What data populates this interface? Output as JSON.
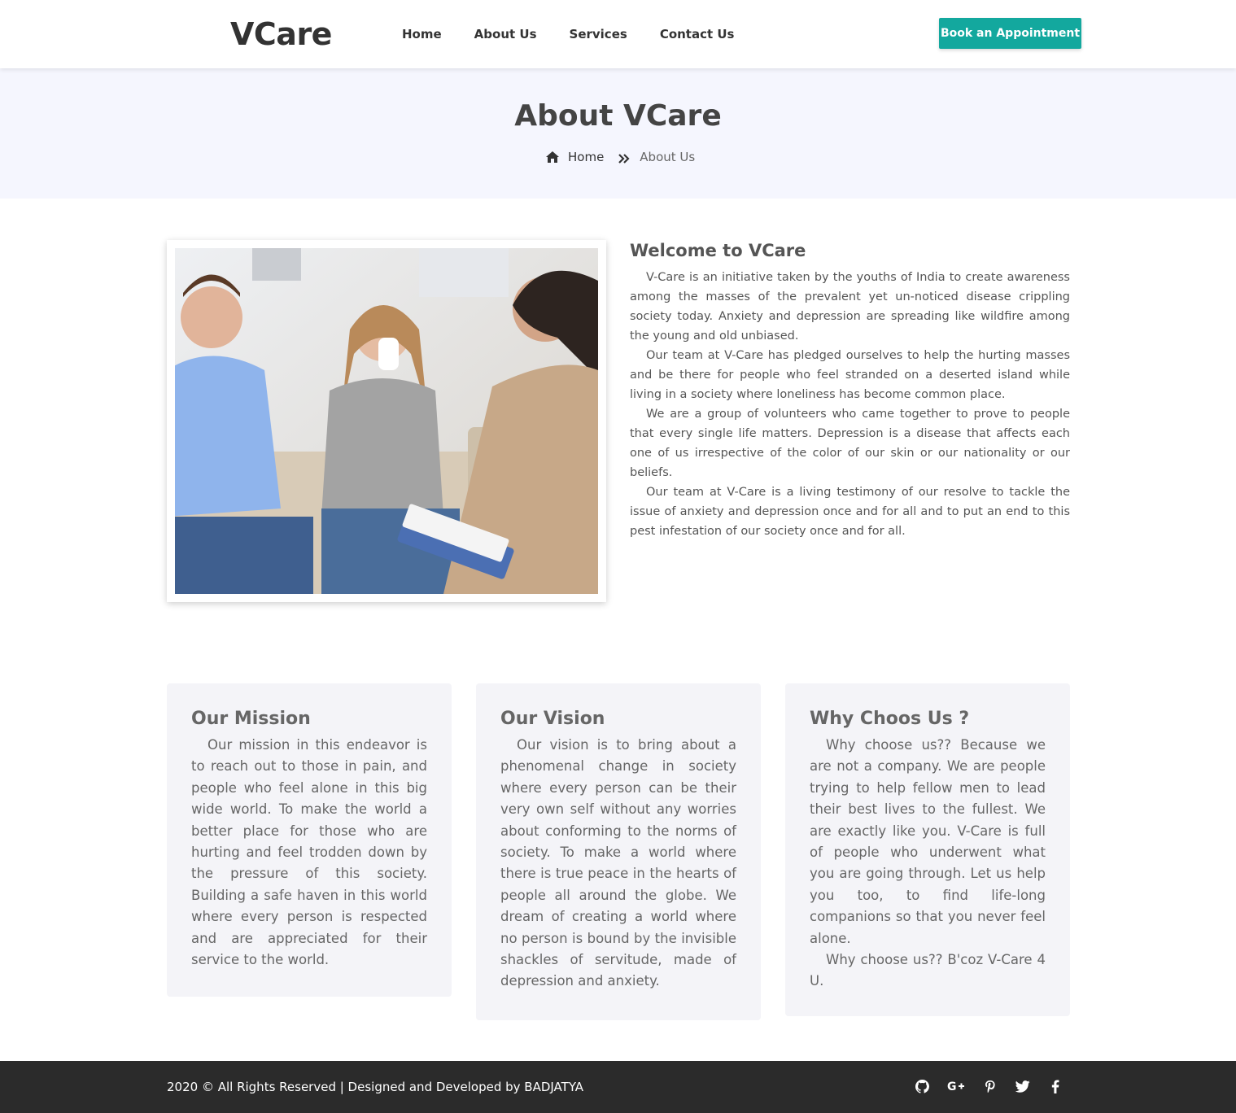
{
  "brand": {
    "logo": "VCare"
  },
  "nav": {
    "items": [
      "Home",
      "About Us",
      "Services",
      "Contact Us"
    ]
  },
  "header": {
    "cta_label": "Book an Appointment"
  },
  "banner": {
    "title": "About VCare",
    "breadcrumb": {
      "home": "Home",
      "current": "About Us"
    }
  },
  "about": {
    "image_alt": "counseling-session-photo",
    "title": "Welcome to VCare",
    "paragraphs": [
      "V-Care is an initiative taken by the youths of India to create awareness among the masses of the prevalent yet un-noticed disease crippling society today. Anxiety and depression are spreading like wildfire among the young and old unbiased.",
      "Our team at V-Care has pledged ourselves to help the hurting masses and be there for people who feel stranded on a deserted island while living in a society where loneliness has become common place.",
      "We are a group of volunteers who came together to prove to people that every single life matters. Depression is a disease that affects each one of us irrespective of the color of our skin or our nationality or our beliefs.",
      "Our team at V-Care is a living testimony of our resolve to tackle the issue of anxiety and depression once and for all and to put an end to this pest infestation of our society once and for all."
    ]
  },
  "cards": [
    {
      "title": "Our Mission",
      "paragraphs": [
        "Our mission in this endeavor is to reach out to those in pain, and people who feel alone in this big wide world. To make the world a better place for those who are hurting and feel trodden down by the pressure of this society. Building a safe haven in this world where every person is respected and are appreciated for their service to the world."
      ]
    },
    {
      "title": "Our Vision",
      "paragraphs": [
        "Our vision is to bring about a phenomenal change in society where every person can be their very own self without any worries about conforming to the norms of society. To make a world where there is true peace in the hearts of people all around the globe. We dream of creating a world where no person is bound by the invisible shackles of servitude, made of depression and anxiety."
      ]
    },
    {
      "title": "Why Choos Us ?",
      "paragraphs": [
        "Why choose us?? Because we are not a company. We are people trying to help fellow men to lead their best lives to the fullest. We are exactly like you. V-Care is full of people who underwent what you are going through. Let us help you too, to find life-long companions so that you never feel alone.",
        "Why choose us?? B'coz V-Care 4 U."
      ]
    }
  ],
  "footer": {
    "copyright": "2020 © All Rights Reserved | Designed and Developed by BADJATYA",
    "socials": [
      "github-icon",
      "google-plus-icon",
      "pinterest-icon",
      "twitter-icon",
      "facebook-icon"
    ]
  },
  "colors": {
    "accent": "#13a89e",
    "banner_bg": "#f5f6fe",
    "card_bg": "#f4f4f8",
    "footer_bg": "#2b2b2b"
  }
}
